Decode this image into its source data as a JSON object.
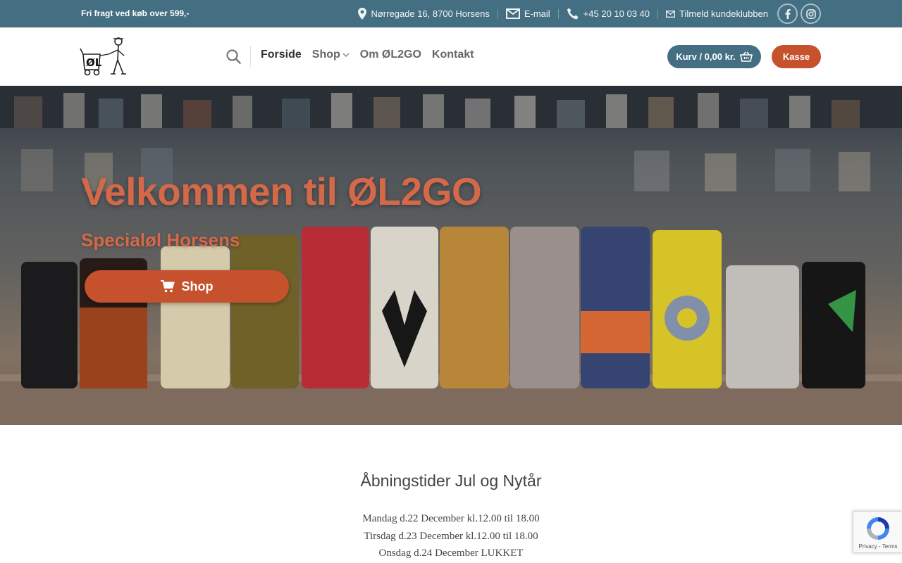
{
  "topbar": {
    "promo": "Fri fragt ved køb over 599,-",
    "address": "Nørregade 16, 8700 Horsens",
    "email": "E-mail",
    "phone": "+45 20 10 03 40",
    "club": "Tilmeld kundeklubben",
    "social": [
      "facebook-icon",
      "instagram-icon"
    ]
  },
  "header": {
    "nav": {
      "home": "Forside",
      "shop": "Shop",
      "about": "Om ØL2GO",
      "contact": "Kontakt"
    },
    "cart_label": "Kurv / 0,00 kr.",
    "checkout_label": "Kasse"
  },
  "hero": {
    "title": "Velkommen til ØL2GO",
    "subtitle": "Specialøl Horsens",
    "button_label": "Shop"
  },
  "content": {
    "hours_title": "Åbningstider Jul og Nytår",
    "hours": [
      "Mandag d.22 December kl.12.00 til 18.00",
      "Tirsdag d.23 December kl.12.00 til 18.00",
      "Onsdag d.24 December LUKKET"
    ]
  },
  "recaptcha": {
    "text": "Privacy - Terms"
  },
  "colors": {
    "topbar": "#446f82",
    "accent": "#c6512d",
    "hero_text": "#d4694a"
  }
}
